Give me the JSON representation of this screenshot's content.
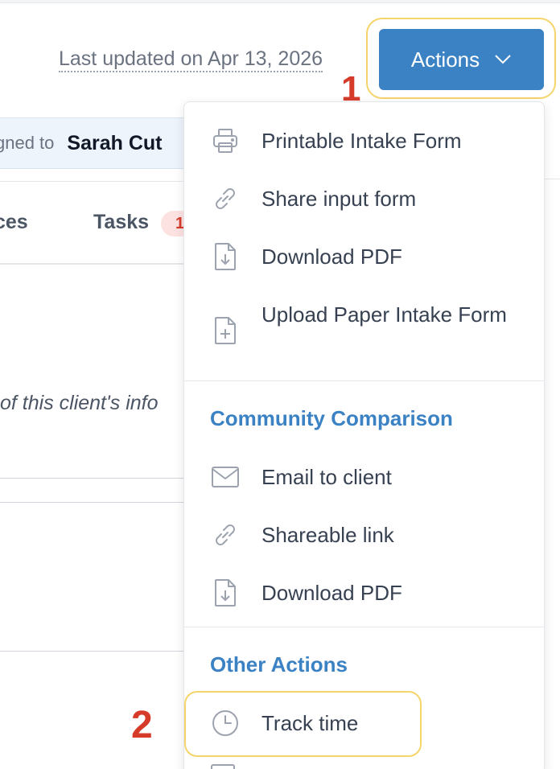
{
  "header": {
    "last_updated": "Last updated on Apr 13, 2026",
    "actions_label": "Actions",
    "actions_icon": "chevron-down-icon"
  },
  "annotations": {
    "step_1": "1",
    "step_2": "2",
    "highlight_color": "#f5d46a",
    "step_color": "#d63b2a"
  },
  "assigned": {
    "label": "gned to",
    "name": "Sarah Cut"
  },
  "tabs": {
    "services": "ices",
    "tasks": "Tasks",
    "tasks_badge": "1"
  },
  "content": {
    "info_text": "of this client's info"
  },
  "menu": {
    "items": [
      {
        "label": "Printable Intake Form",
        "icon": "printer-icon"
      },
      {
        "label": "Share input form",
        "icon": "link-icon"
      },
      {
        "label": "Download PDF",
        "icon": "file-download-icon"
      },
      {
        "label": "Upload Paper Intake Form",
        "icon": "file-plus-icon"
      }
    ],
    "community_header": "Community Comparison",
    "community_items": [
      {
        "label": "Email to client",
        "icon": "envelope-icon"
      },
      {
        "label": "Shareable link",
        "icon": "link-icon"
      },
      {
        "label": "Download PDF",
        "icon": "file-download-icon"
      }
    ],
    "other_header": "Other Actions",
    "other_items": [
      {
        "label": "Track time",
        "icon": "clock-icon"
      }
    ]
  },
  "colors": {
    "accent": "#3b82c4",
    "text": "#374151",
    "icon": "#9ca3af"
  }
}
